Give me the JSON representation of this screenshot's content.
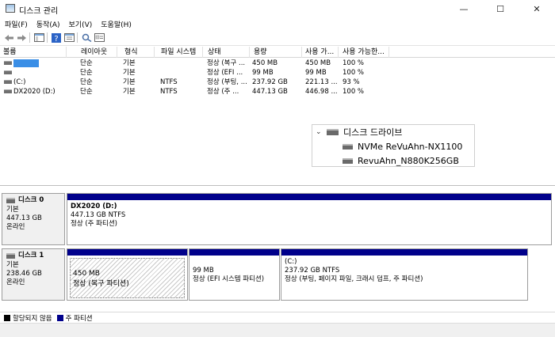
{
  "window": {
    "title": "디스크 관리",
    "controls": {
      "minimize": "—",
      "maximize": "☐",
      "close": "✕"
    }
  },
  "menu": [
    "파일(F)",
    "동작(A)",
    "보기(V)",
    "도움말(H)"
  ],
  "toolbar": {
    "icons": [
      "back-arrow-icon",
      "forward-arrow-icon",
      "console-tree-icon",
      "help-icon",
      "properties-icon",
      "rescan-icon",
      "settings-icon"
    ]
  },
  "volume_list": {
    "columns": [
      "볼륨",
      "레이아웃",
      "형식",
      "파일 시스템",
      "상태",
      "용량",
      "사용 가...",
      "사용 가능한..."
    ],
    "rows": [
      {
        "volume": "",
        "layout": "단순",
        "type": "기본",
        "fs": "",
        "status": "정상 (복구 ...",
        "capacity": "450 MB",
        "free": "450 MB",
        "pct": "100 %",
        "selected": true
      },
      {
        "volume": "",
        "layout": "단순",
        "type": "기본",
        "fs": "",
        "status": "정상 (EFI ...",
        "capacity": "99 MB",
        "free": "99 MB",
        "pct": "100 %",
        "selected": false
      },
      {
        "volume": "(C:)",
        "layout": "단순",
        "type": "기본",
        "fs": "NTFS",
        "status": "정상 (부팅, ...",
        "capacity": "237.92 GB",
        "free": "221.13 ...",
        "pct": "93 %",
        "selected": false
      },
      {
        "volume": "DX2020 (D:)",
        "layout": "단순",
        "type": "기본",
        "fs": "NTFS",
        "status": "정상 (주 ...",
        "capacity": "447.13 GB",
        "free": "446.98 ...",
        "pct": "100 %",
        "selected": false
      }
    ]
  },
  "drive_popup": {
    "header": "디스크 드라이브",
    "items": [
      "NVMe ReVuAhn-NX1100",
      "RevuAhn_N880K256GB"
    ]
  },
  "disks": [
    {
      "name": "디스크 0",
      "type": "기본",
      "size": "447.13 GB",
      "status": "온라인",
      "partitions": [
        {
          "title": "DX2020  (D:)",
          "size": "447.13 GB NTFS",
          "status": "정상 (주 파티션)"
        }
      ]
    },
    {
      "name": "디스크 1",
      "type": "기본",
      "size": "238.46 GB",
      "status": "온라인",
      "partitions": [
        {
          "title": "",
          "size": "450 MB",
          "status": "정상 (복구 파티션)"
        },
        {
          "title": "",
          "size": "99 MB",
          "status": "정상 (EFI 시스템 파티션)"
        },
        {
          "title": "(C:)",
          "size": "237.92 GB NTFS",
          "status": "정상 (부팅, 페이지 파일, 크래시 덤프, 주 파티션)"
        }
      ]
    }
  ],
  "legend": [
    {
      "label": "할당되지 않음",
      "color": "#000000"
    },
    {
      "label": "주 파티션",
      "color": "#00008b"
    }
  ],
  "colors": {
    "selection": "#3a8ee6",
    "primary_partition": "#00008b"
  }
}
